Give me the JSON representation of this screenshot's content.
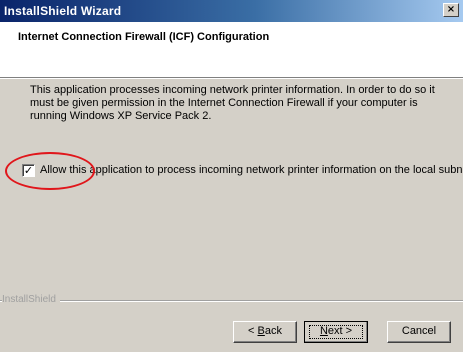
{
  "window": {
    "title": "InstallShield Wizard",
    "close_glyph": "×"
  },
  "header": {
    "heading": "Internet Connection Firewall (ICF) Configuration"
  },
  "body": {
    "description": "This application processes incoming network printer information. In order to do so it must be given permission in the Internet Connection Firewall if your computer is running Windows XP Service Pack 2.",
    "checkbox": {
      "checked": true,
      "check_glyph": "✓",
      "label": "Allow this application to process incoming network printer information on the local subnet."
    },
    "annotation_color": "#e0161b"
  },
  "footer": {
    "brand": "InstallShield",
    "back": {
      "mnemonic": "B",
      "rest": "ack",
      "prefix": "< "
    },
    "next": {
      "mnemonic": "N",
      "rest": "ext >"
    },
    "cancel": "Cancel"
  }
}
